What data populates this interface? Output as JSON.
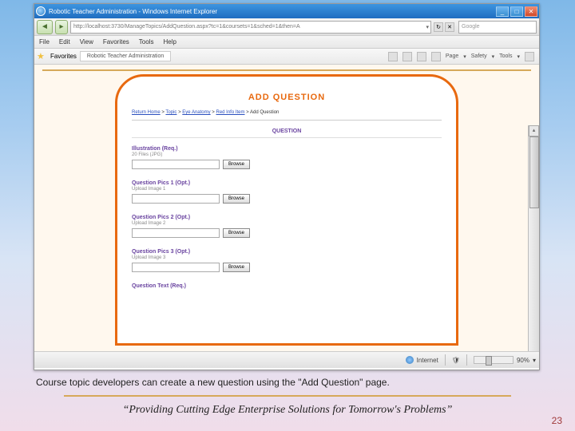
{
  "browser": {
    "title": "Robotic Teacher Administration - Windows Internet Explorer",
    "url": "http://localhost:3730/ManageTopics/AddQuestion.aspx?tc=1&coursets=1&sched=1&then=A",
    "search_placeholder": "Google",
    "menus": [
      "File",
      "Edit",
      "View",
      "Favorites",
      "Tools",
      "Help"
    ],
    "fav_label": "Favorites",
    "tab_label": "Robotic Teacher Administration",
    "tools": {
      "page": "Page",
      "safety": "Safety",
      "tools": "Tools"
    },
    "status": {
      "zone": "Internet",
      "zoom": "90%"
    }
  },
  "page": {
    "heading": "ADD QUESTION",
    "breadcrumb": {
      "items": [
        "Return Home",
        "Topic",
        "Eye Anatomy",
        "Red Info Item"
      ],
      "current": "Add Question"
    },
    "section_header": "QUESTION",
    "fields": [
      {
        "label": "Illustration (Req.)",
        "sub": "20 Files (JPG)",
        "browse": "Browse"
      },
      {
        "label": "Question Pics 1 (Opt.)",
        "sub": "Upload Image 1",
        "browse": "Browse"
      },
      {
        "label": "Question Pics 2 (Opt.)",
        "sub": "Upload Image 2",
        "browse": "Browse"
      },
      {
        "label": "Question Pics 3 (Opt.)",
        "sub": "Upload Image 3",
        "browse": "Browse"
      },
      {
        "label": "Question Text (Req.)",
        "sub": "",
        "browse": ""
      }
    ]
  },
  "slide": {
    "caption": "Course topic developers can create a new question using the \"Add Question\" page.",
    "tagline": "“Providing Cutting Edge Enterprise Solutions for Tomorrow's Problems”",
    "page_number": "23"
  }
}
